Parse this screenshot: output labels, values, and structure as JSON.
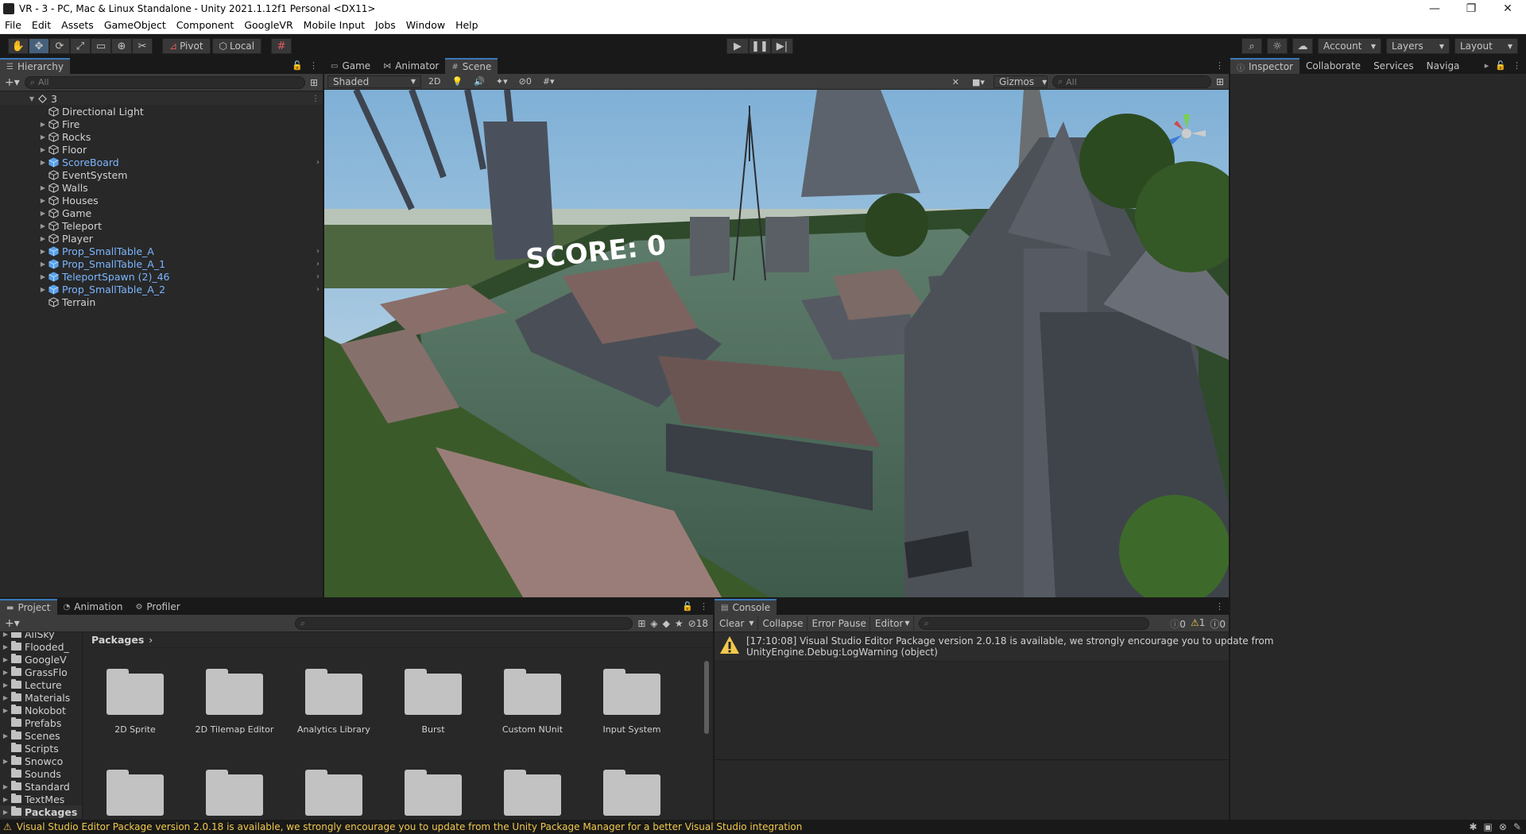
{
  "window": {
    "title": "VR - 3 - PC, Mac & Linux Standalone - Unity 2021.1.12f1 Personal <DX11>",
    "controls": [
      "—",
      "❐",
      "✕"
    ]
  },
  "menu": [
    "File",
    "Edit",
    "Assets",
    "GameObject",
    "Component",
    "GoogleVR",
    "Mobile Input",
    "Jobs",
    "Window",
    "Help"
  ],
  "toolbar": {
    "pivot_label": "Pivot",
    "local_label": "Local",
    "account_label": "Account",
    "layers_label": "Layers",
    "layout_label": "Layout"
  },
  "hierarchy": {
    "tab_label": "Hierarchy",
    "search_placeholder": "All",
    "scene_name": "3",
    "items": [
      {
        "label": "Directional Light",
        "prefab": false,
        "expandable": false
      },
      {
        "label": "Fire",
        "prefab": false,
        "expandable": true
      },
      {
        "label": "Rocks",
        "prefab": false,
        "expandable": true
      },
      {
        "label": "Floor",
        "prefab": false,
        "expandable": true
      },
      {
        "label": "ScoreBoard",
        "prefab": true,
        "expandable": true
      },
      {
        "label": "EventSystem",
        "prefab": false,
        "expandable": false
      },
      {
        "label": "Walls",
        "prefab": false,
        "expandable": true
      },
      {
        "label": "Houses",
        "prefab": false,
        "expandable": true
      },
      {
        "label": "Game",
        "prefab": false,
        "expandable": true
      },
      {
        "label": "Teleport",
        "prefab": false,
        "expandable": true
      },
      {
        "label": "Player",
        "prefab": false,
        "expandable": true
      },
      {
        "label": "Prop_SmallTable_A",
        "prefab": true,
        "expandable": true
      },
      {
        "label": "Prop_SmallTable_A_1",
        "prefab": true,
        "expandable": true
      },
      {
        "label": "TeleportSpawn (2)_46",
        "prefab": true,
        "expandable": true
      },
      {
        "label": "Prop_SmallTable_A_2",
        "prefab": true,
        "expandable": true
      },
      {
        "label": "Terrain",
        "prefab": false,
        "expandable": false
      }
    ]
  },
  "scene": {
    "tabs": [
      "Game",
      "Animator",
      "Scene"
    ],
    "active_tab": "Scene",
    "shading_mode": "Shaded",
    "mode_2d": "2D",
    "hidden_count": "0",
    "gizmos_label": "Gizmos",
    "search_placeholder": "All",
    "score_text": "SCORE: 0"
  },
  "inspector": {
    "tabs": [
      "Inspector",
      "Collaborate",
      "Services",
      "Naviga"
    ]
  },
  "project": {
    "tabs": [
      "Project",
      "Animation",
      "Profiler"
    ],
    "hidden_packages_count": "18",
    "breadcrumb": "Packages",
    "tree": [
      {
        "label": "AllSky",
        "expandable": true
      },
      {
        "label": "Flooded_",
        "expandable": true
      },
      {
        "label": "GoogleV",
        "expandable": true
      },
      {
        "label": "GrassFlo",
        "expandable": true
      },
      {
        "label": "Lecture",
        "expandable": true
      },
      {
        "label": "Materials",
        "expandable": true
      },
      {
        "label": "Nokobot",
        "expandable": true
      },
      {
        "label": "Prefabs",
        "expandable": false
      },
      {
        "label": "Scenes",
        "expandable": true
      },
      {
        "label": "Scripts",
        "expandable": false
      },
      {
        "label": "Snowco",
        "expandable": true
      },
      {
        "label": "Sounds",
        "expandable": false
      },
      {
        "label": "Standard",
        "expandable": true
      },
      {
        "label": "TextMes",
        "expandable": true
      }
    ],
    "tree_root": "Packages",
    "packages": [
      "2D Sprite",
      "2D Tilemap Editor",
      "Analytics Library",
      "Burst",
      "Custom NUnit",
      "Input System"
    ]
  },
  "console": {
    "tab_label": "Console",
    "clear_label": "Clear",
    "collapse_label": "Collapse",
    "error_pause_label": "Error Pause",
    "editor_label": "Editor",
    "log_count": "0",
    "warn_count": "1",
    "error_count": "0",
    "entry_line1": "[17:10:08] Visual Studio Editor Package version 2.0.18 is available, we strongly encourage you to update from",
    "entry_line2": "UnityEngine.Debug:LogWarning (object)"
  },
  "statusbar": {
    "message": "Visual Studio Editor Package version 2.0.18 is available, we strongly encourage you to update from the Unity Package Manager for a better Visual Studio integration"
  },
  "colors": {
    "accent_blue": "#3a79bb",
    "prefab_blue": "#7bb6ff",
    "warning_yellow": "#f2c94c"
  }
}
